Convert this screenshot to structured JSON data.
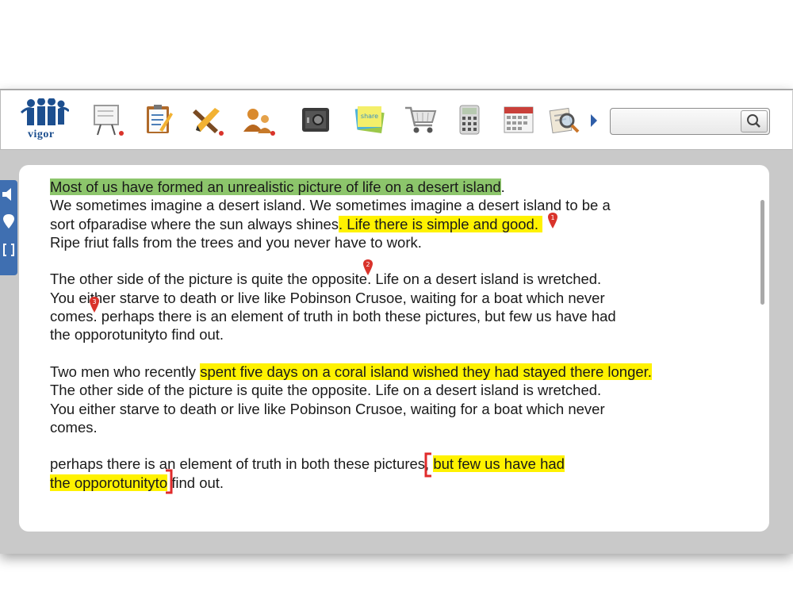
{
  "toolbar": {
    "logo_text": "vigor",
    "tools": [
      {
        "icon": "presentation-board-icon"
      },
      {
        "icon": "clipboard-notes-icon"
      },
      {
        "icon": "pencil-ruler-icon"
      },
      {
        "icon": "users-icon"
      },
      {
        "icon": "safe-icon"
      },
      {
        "icon": "share-notes-icon",
        "label": "share"
      },
      {
        "icon": "shopping-cart-icon"
      },
      {
        "icon": "calculator-icon"
      },
      {
        "icon": "calendar-icon"
      },
      {
        "icon": "magnifier-document-icon"
      }
    ],
    "search": {
      "placeholder": "",
      "value": ""
    }
  },
  "sidebar": {
    "icons": [
      "speaker-icon",
      "pin-icon",
      "bracket-icon"
    ]
  },
  "document": {
    "p1": {
      "l1": "Most  of us have formed an unrealistic picture of life on a desert island",
      "l1_end": ".",
      "l2": "We sometimes imagine a desert island. We sometimes imagine a desert island to be a",
      "l3a": "sort ofparadise where the sun always shines",
      "l3b": ". Life there is simple and good. ",
      "l4": "Ripe friut falls from the trees and you never have to work."
    },
    "p2": {
      "l1a": "The other side of the picture is quite the opposite",
      "l1b": ". Life on a desert island is wretched.",
      "l2": "You either starve to death or live like Pobinson Crusoe, waiting for a boat which never",
      "l3a": "comes",
      "l3b": ". perhaps there is an element of truth in both these pictures, but few us have had",
      "l4": "the opporotunityto find out."
    },
    "p3": {
      "l1a": "Two men who recently ",
      "l1b": "spent five days on a coral island wished they had stayed there longer.",
      "l2": "The other side of the picture is quite the opposite. Life on a desert island is wretched.",
      "l3": "You either starve to death or live like Pobinson Crusoe, waiting for a boat which never",
      "l4": "comes."
    },
    "p4": {
      "l1a": "perhaps there is an element of truth in both these pictures, ",
      "l1b": "but few us have had",
      "l2a": "the opporotunityto",
      "l2b": " find out."
    },
    "pins": [
      "1",
      "2",
      "3"
    ]
  },
  "colors": {
    "highlight_green": "#8cc56b",
    "highlight_yellow": "#fff200",
    "pin_red": "#d9332b",
    "bracket_red": "#e02b2b",
    "side_tab_blue": "#3f6fb1"
  }
}
